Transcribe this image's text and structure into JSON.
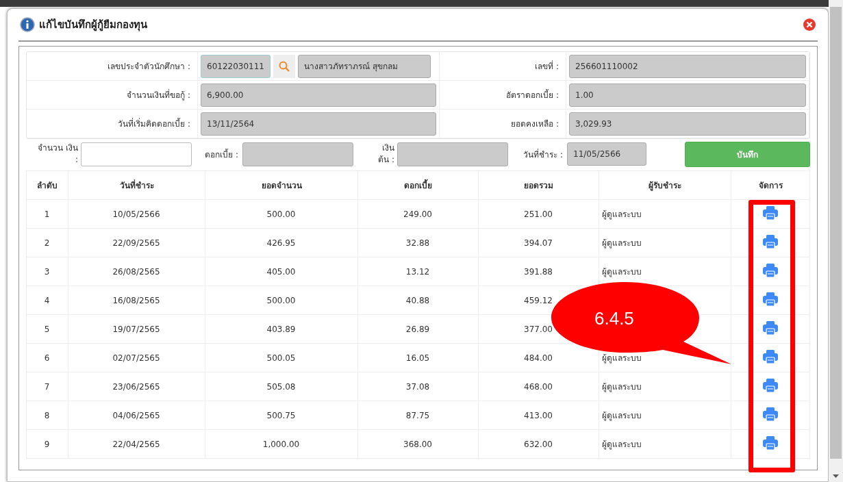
{
  "dialog": {
    "title": "แก้ไขบันทึกผู้กู้ยืมกองทุน"
  },
  "form": {
    "student_id_label": "เลขประจำตัวนักศึกษา :",
    "student_id": "60122030111",
    "student_name": "นางสาวภัทราภรณ์  สุขกลม",
    "fields": [
      {
        "label": "จำนวนเงินที่ขอกู้ :",
        "value": "6,900.00"
      },
      {
        "label": "วันที่เริ่มคิดดอกเบี้ย :",
        "value": "13/11/2564"
      }
    ],
    "right_fields": [
      {
        "label": "เลขที่ :",
        "value": "256601110002"
      },
      {
        "label": "อัตราดอกเบี้ย :",
        "value": "1.00"
      },
      {
        "label": "ยอดคงเหลือ :",
        "value": "3,029.93"
      }
    ]
  },
  "payment": {
    "amount_label": "จำนวน เงิน :",
    "interest_label": "ดอกเบี้ย :",
    "principal_label": "เงิน ต้น :",
    "date_label": "วันที่ชำระ :",
    "date": "11/05/2566",
    "save_button": "บันทึก"
  },
  "table": {
    "columns": [
      "ลำดับ",
      "วันที่ชำระ",
      "ยอดจำนวน",
      "ดอกเบี้ย",
      "ยอดรวม",
      "ผู้รับชำระ",
      "จัดการ"
    ],
    "rows": [
      {
        "no": "1",
        "date": "10/05/2566",
        "amount": "500.00",
        "interest": "249.00",
        "total": "251.00",
        "receiver": "ผู้ดูแลระบบ"
      },
      {
        "no": "2",
        "date": "22/09/2565",
        "amount": "426.95",
        "interest": "32.88",
        "total": "394.07",
        "receiver": "ผู้ดูแลระบบ"
      },
      {
        "no": "3",
        "date": "26/08/2565",
        "amount": "405.00",
        "interest": "13.12",
        "total": "391.88",
        "receiver": "ผู้ดูแลระบบ"
      },
      {
        "no": "4",
        "date": "16/08/2565",
        "amount": "500.00",
        "interest": "40.88",
        "total": "459.12"
      },
      {
        "no": "5",
        "date": "19/07/2565",
        "amount": "403.89",
        "interest": "26.89",
        "total": "377.00"
      },
      {
        "no": "6",
        "date": "02/07/2565",
        "amount": "500.05",
        "interest": "16.05",
        "total": "484.00",
        "receiver": "ผู้ดูแลระบบ"
      },
      {
        "no": "7",
        "date": "23/06/2565",
        "amount": "505.08",
        "interest": "37.08",
        "total": "468.00",
        "receiver": "ผู้ดูแลระบบ"
      },
      {
        "no": "8",
        "date": "04/06/2565",
        "amount": "500.75",
        "interest": "87.75",
        "total": "413.00",
        "receiver": "ผู้ดูแลระบบ"
      },
      {
        "no": "9",
        "date": "22/04/2565",
        "amount": "1,000.00",
        "interest": "368.00",
        "total": "632.00",
        "receiver": "ผู้ดูแลระบบ"
      }
    ]
  },
  "annotation": {
    "callout": "6.4.5"
  }
}
